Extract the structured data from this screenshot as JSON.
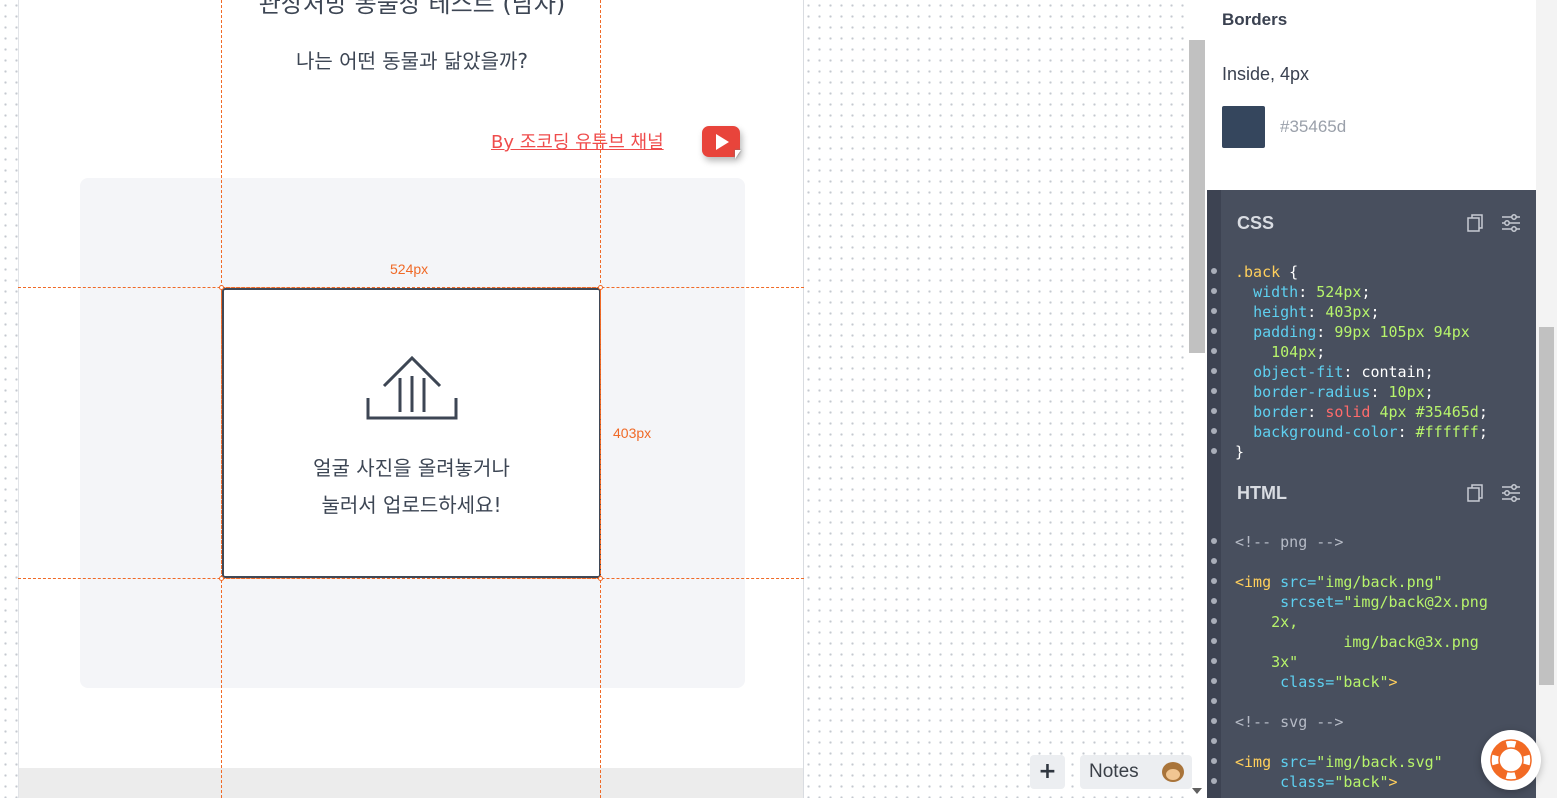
{
  "artboard": {
    "title": "관상처방 동물상 테스트 (남자)",
    "subtitle": "나는 어떤 동물과 닮았을까?",
    "youtube_link": "By 조코딩 유튜브 채널",
    "youtube_icon": "youtube-play-icon",
    "upload_icon": "upload-icon",
    "upload_text_line1": "얼굴 사진을 올려놓거나",
    "upload_text_line2": "눌러서 업로드하세요!"
  },
  "measurements": {
    "width_label": "524px",
    "height_label": "403px"
  },
  "bottom_bar": {
    "add_label": "+",
    "notes_label": "Notes",
    "notes_icon": "monkey-icon"
  },
  "inspector": {
    "borders_heading": "Borders",
    "border_value": "Inside, 4px",
    "border_color_hex": "#35465d",
    "css_title": "CSS",
    "html_title": "HTML",
    "copy_icon": "copy-icon",
    "settings_icon": "sliders-icon",
    "css_code": {
      "selector": ".back",
      "width": "524px",
      "height": "403px",
      "padding_1": "99px 105px 94px",
      "padding_2": "104px",
      "object_fit": "contain",
      "border_radius": "10px",
      "border_style": "solid",
      "border_rest": "4px #35465d",
      "background_color": "#ffffff"
    },
    "html_code": {
      "comment_png": "<!-- png -->",
      "img_tag": "<img",
      "src_attr": "src=",
      "src_png": "\"img/back.png\"",
      "srcset_attr": "srcset=",
      "srcset_1": "\"img/back@2x.png",
      "srcset_1b": "2x,",
      "srcset_2": "img/back@3x.png",
      "srcset_2b": "3x\"",
      "class_attr": "class=",
      "class_val": "\"back\"",
      "close": ">",
      "comment_svg": "<!-- svg -->",
      "src_svg": "\"img/back.svg\""
    }
  },
  "help": {
    "icon": "lifebuoy-icon"
  }
}
